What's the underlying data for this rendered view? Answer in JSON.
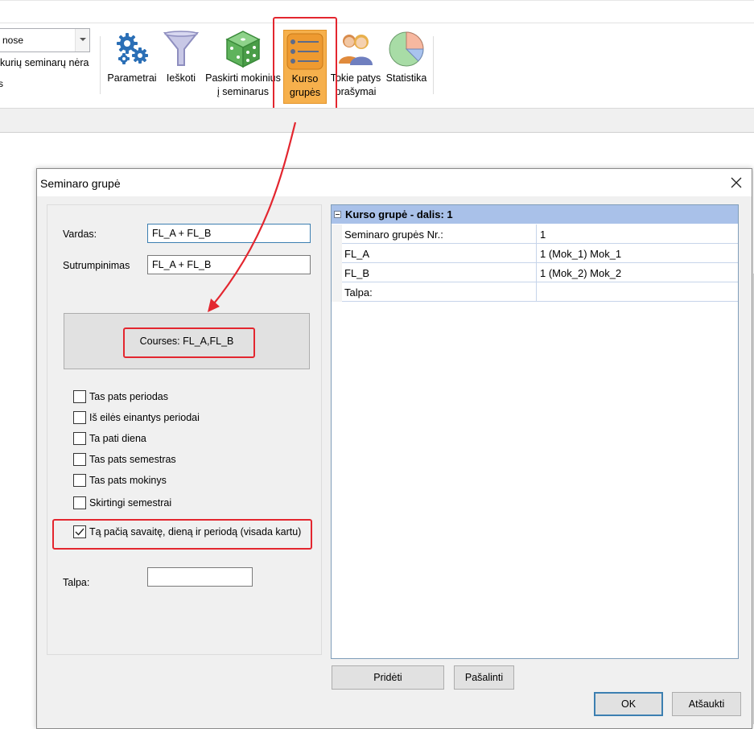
{
  "ribbon": {
    "combo_value": "nose",
    "note_text": "kurių seminarų nėra",
    "small_text": "s",
    "buttons": [
      {
        "name": "parametrai",
        "label1": "Parametrai",
        "label2": ""
      },
      {
        "name": "ieskoti",
        "label1": "Ieškoti",
        "label2": ""
      },
      {
        "name": "paskirti",
        "label1": "Paskirti mokinius",
        "label2": "į seminarus"
      },
      {
        "name": "kurso-grupes",
        "label1": "Kurso",
        "label2": "grupės"
      },
      {
        "name": "tokie-patys",
        "label1": "Tokie patys",
        "label2": "prašymai"
      },
      {
        "name": "statistika",
        "label1": "Statistika",
        "label2": ""
      }
    ]
  },
  "dialog": {
    "title": "Seminaro grupė",
    "vardas_label": "Vardas:",
    "vardas_value": "FL_A + FL_B",
    "sutrumpinimas_label": "Sutrumpinimas",
    "sutrumpinimas_value": "FL_A + FL_B",
    "courses_text": "Courses: FL_A,FL_B",
    "checkboxes": [
      {
        "label": "Tas pats periodas",
        "checked": false
      },
      {
        "label": "Iš eilės einantys periodai",
        "checked": false
      },
      {
        "label": "Ta pati diena",
        "checked": false
      },
      {
        "label": "Tas pats semestras",
        "checked": false
      },
      {
        "label": "Tas pats mokinys",
        "checked": false
      },
      {
        "label": "Skirtingi semestrai",
        "checked": false
      },
      {
        "label": "Tą pačią savaitę, dieną ir periodą (visada kartu)",
        "checked": true
      }
    ],
    "talpa_label": "Talpa:",
    "talpa_value": "",
    "grid": {
      "header": "Kurso grupė - dalis: 1",
      "rows": [
        {
          "label": "Seminaro grupės Nr.:",
          "value": "1"
        },
        {
          "label": "FL_A",
          "value": "1 (Mok_1) Mok_1"
        },
        {
          "label": "FL_B",
          "value": "1 (Mok_2) Mok_2"
        },
        {
          "label": "Talpa:",
          "value": ""
        }
      ]
    },
    "buttons": {
      "add": "Pridėti",
      "remove": "Pašalinti",
      "ok": "OK",
      "cancel": "Atšaukti"
    }
  },
  "colors": {
    "active_button": "#f6b04c",
    "highlight": "#e3262f",
    "grid_header": "#a9c1e9"
  }
}
